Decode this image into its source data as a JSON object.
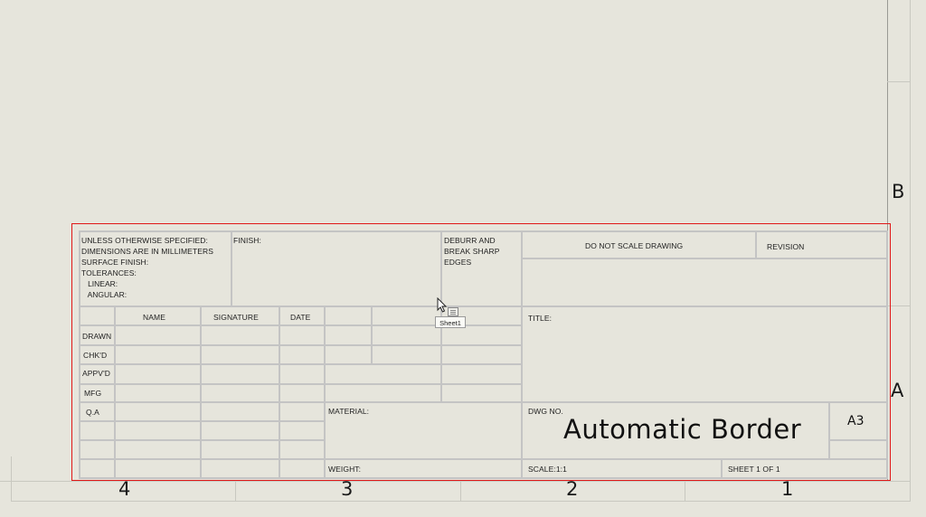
{
  "zones": {
    "row_b": "B",
    "row_a": "A",
    "col_4": "4",
    "col_3": "3",
    "col_2": "2",
    "col_1": "1"
  },
  "title_block": {
    "spec_lines": [
      "UNLESS OTHERWISE SPECIFIED:",
      "DIMENSIONS ARE IN MILLIMETERS",
      "SURFACE FINISH:",
      "TOLERANCES:",
      "   LINEAR:",
      "   ANGULAR:"
    ],
    "finish": "FINISH:",
    "deburr_lines": [
      "DEBURR AND",
      "BREAK SHARP",
      "EDGES"
    ],
    "do_not_scale": "DO NOT SCALE DRAWING",
    "revision": "REVISION",
    "columns": [
      "NAME",
      "SIGNATURE",
      "DATE"
    ],
    "rows": [
      "DRAWN",
      "CHK'D",
      "APPV'D",
      "MFG",
      "Q.A"
    ],
    "title_label": "TITLE:",
    "material": "MATERIAL:",
    "dwg_no_label": "DWG NO.",
    "dwg_no_value": "Automatic Border",
    "sheet_size": "A3",
    "weight": "WEIGHT:",
    "scale": "SCALE:1:1",
    "sheet": "SHEET 1 OF 1"
  },
  "tooltip": "Sheet1",
  "colors": {
    "background": "#e6e5dc",
    "selection_border": "#e01818",
    "grid_lines": "#c4c4c4"
  }
}
